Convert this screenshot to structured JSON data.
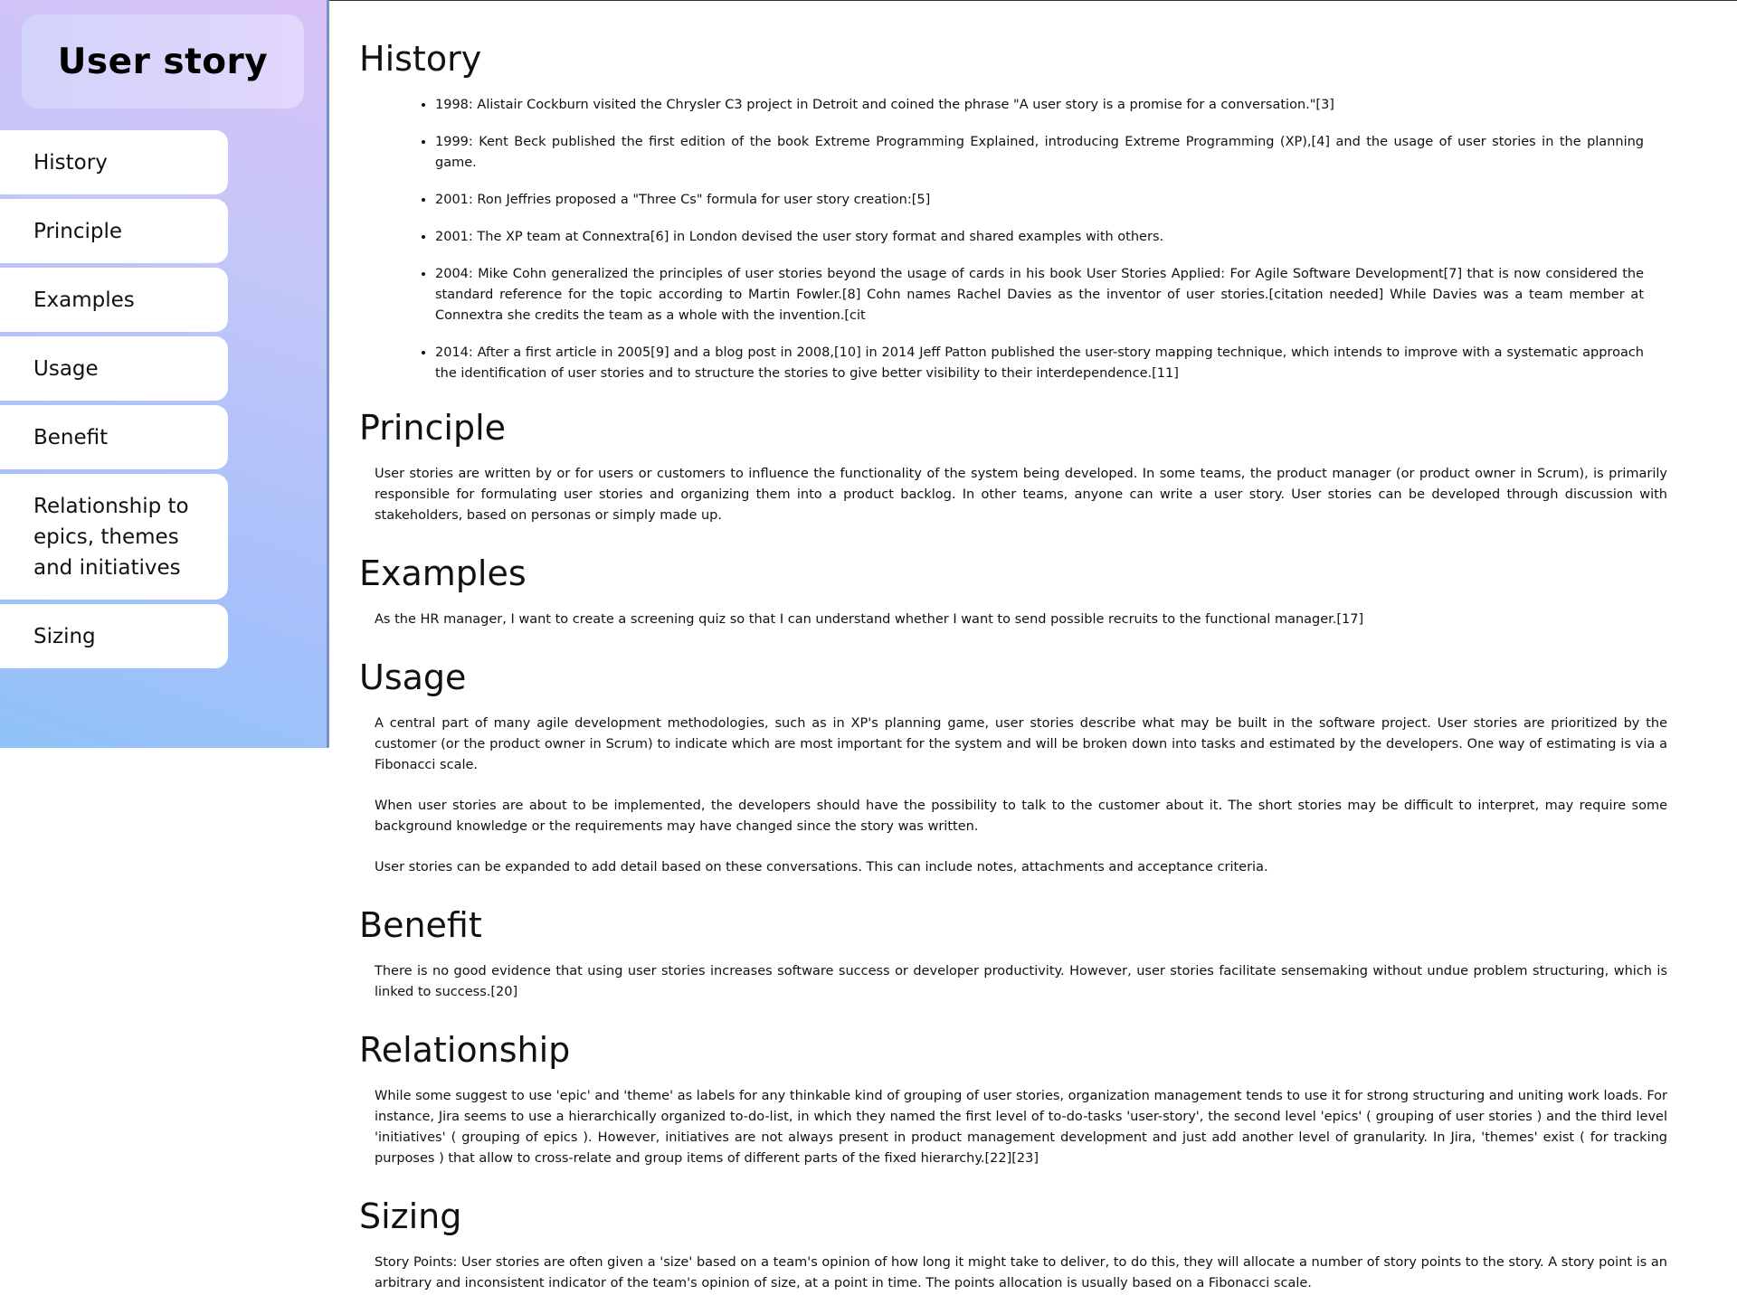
{
  "sidebar": {
    "title": "User story",
    "items": [
      {
        "label": "History"
      },
      {
        "label": "Principle"
      },
      {
        "label": "Examples"
      },
      {
        "label": "Usage"
      },
      {
        "label": "Benefit"
      },
      {
        "label": "Relationship to epics, themes and initiatives"
      },
      {
        "label": "Sizing"
      }
    ]
  },
  "sections": {
    "history": {
      "heading": "History",
      "items": [
        "1998: Alistair Cockburn visited the Chrysler C3 project in Detroit and coined the phrase \"A user story is a promise for a conversation.\"[3]",
        "1999: Kent Beck published the first edition of the book Extreme Programming Explained, introducing Extreme Programming (XP),[4] and the usage of user stories in the planning game.",
        "2001: Ron Jeffries proposed a \"Three Cs\" formula for user story creation:[5]",
        "2001: The XP team at Connextra[6] in London devised the user story format and shared examples with others.",
        "2004: Mike Cohn generalized the principles of user stories beyond the usage of cards in his book User Stories Applied: For Agile Software Development[7] that is now considered the standard reference for the topic according to Martin Fowler.[8] Cohn names Rachel Davies as the inventor of user stories.[citation needed] While Davies was a team member at Connextra she credits the team as a whole with the invention.[cit",
        "2014: After a first article in 2005[9] and a blog post in 2008,[10] in 2014 Jeff Patton published the user-story mapping technique, which intends to improve with a systematic approach the identification of user stories and to structure the stories to give better visibility to their interdependence.[11]"
      ]
    },
    "principle": {
      "heading": "Principle",
      "paragraphs": [
        "User stories are written by or for users or customers to influence the functionality of the system being developed. In some teams, the product manager (or product owner in Scrum), is primarily responsible for formulating user stories and organizing them into a product backlog. In other teams, anyone can write a user story. User stories can be developed through discussion with stakeholders, based on personas or simply made up."
      ]
    },
    "examples": {
      "heading": "Examples",
      "paragraphs": [
        "As the HR manager, I want to create a screening quiz so that I can understand whether I want to send possible recruits to the functional manager.[17]"
      ]
    },
    "usage": {
      "heading": "Usage",
      "paragraphs": [
        "A central part of many agile development methodologies, such as in XP's planning game, user stories describe what may be built in the software project. User stories are prioritized by the customer (or the product owner in Scrum) to indicate which are most important for the system and will be broken down into tasks and estimated by the developers. One way of estimating is via a Fibonacci scale.",
        "When user stories are about to be implemented, the developers should have the possibility to talk to the customer about it. The short stories may be difficult to interpret, may require some background knowledge or the requirements may have changed since the story was written.",
        "User stories can be expanded to add detail based on these conversations. This can include notes, attachments and acceptance criteria."
      ]
    },
    "benefit": {
      "heading": "Benefit",
      "paragraphs": [
        "There is no good evidence that using user stories increases software success or developer productivity. However, user stories facilitate sensemaking without undue problem structuring, which is linked to success.[20]"
      ]
    },
    "relationship": {
      "heading": "Relationship",
      "paragraphs": [
        "While some suggest to use 'epic' and 'theme' as labels for any thinkable kind of grouping of user stories, organization management tends to use it for strong structuring and uniting work loads. For instance, Jira seems to use a hierarchically organized to-do-list, in which they named the first level of to-do-tasks 'user-story', the second level 'epics' ( grouping of user stories ) and the third level 'initiatives' ( grouping of epics ). However, initiatives are not always present in product management development and just add another level of granularity. In Jira, 'themes' exist ( for tracking purposes ) that allow to cross-relate and group items of different parts of the fixed hierarchy.[22][23]"
      ]
    },
    "sizing": {
      "heading": "Sizing",
      "paragraphs": [
        "Story Points: User stories are often given a 'size' based on a team's opinion of how long it might take to deliver, to do this, they will allocate a number of story points to the story. A story point is an arbitrary and inconsistent indicator of the team's opinion of size, at a point in time. The points allocation is usually based on a Fibonacci scale."
      ]
    }
  }
}
